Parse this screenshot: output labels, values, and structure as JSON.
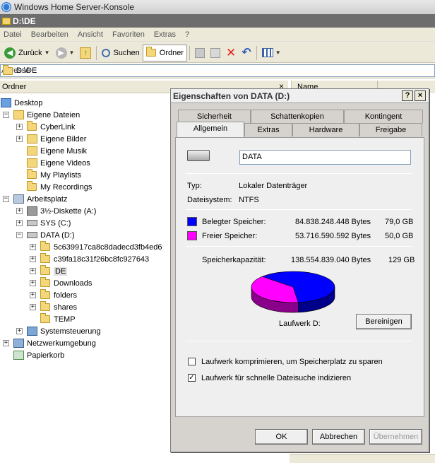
{
  "app": {
    "title": "Windows Home Server-Konsole",
    "doc_title": "D:\\DE"
  },
  "menu": [
    "Datei",
    "Bearbeiten",
    "Ansicht",
    "Favoriten",
    "Extras",
    "?"
  ],
  "toolbar": {
    "back_label": "Zurück",
    "search_label": "Suchen",
    "folders_label": "Ordner"
  },
  "address": {
    "label": "Adresse",
    "value": "D:\\DE"
  },
  "tree": {
    "header": "Ordner",
    "close": "×",
    "nodes": [
      {
        "label": "Desktop"
      },
      {
        "label": "Eigene Dateien"
      },
      {
        "label": "CyberLink"
      },
      {
        "label": "Eigene Bilder"
      },
      {
        "label": "Eigene Musik"
      },
      {
        "label": "Eigene Videos"
      },
      {
        "label": "My Playlists"
      },
      {
        "label": "My Recordings"
      },
      {
        "label": "Arbeitsplatz"
      },
      {
        "label": "3½-Diskette (A:)"
      },
      {
        "label": "SYS (C:)"
      },
      {
        "label": "DATA (D:)"
      },
      {
        "label": "5c639917ca8c8dadecd3fb4ed6"
      },
      {
        "label": "c39fa18c31f26bc8fc927643"
      },
      {
        "label": "DE"
      },
      {
        "label": "Downloads"
      },
      {
        "label": "folders"
      },
      {
        "label": "shares"
      },
      {
        "label": "TEMP"
      },
      {
        "label": "Systemsteuerung"
      },
      {
        "label": "Netzwerkumgebung"
      },
      {
        "label": "Papierkorb"
      }
    ]
  },
  "list_header": {
    "name": "Name"
  },
  "dialog": {
    "title": "Eigenschaften von DATA (D:)",
    "help": "?",
    "close": "×",
    "tabs_back": [
      "Sicherheit",
      "Schattenkopien",
      "Kontingent"
    ],
    "tabs_front": [
      "Allgemein",
      "Extras",
      "Hardware",
      "Freigabe"
    ],
    "drive_name": "DATA",
    "type_label": "Typ:",
    "type_value": "Lokaler Datenträger",
    "fs_label": "Dateisystem:",
    "fs_value": "NTFS",
    "used": {
      "label": "Belegter Speicher:",
      "bytes": "84.838.248.448 Bytes",
      "size": "79,0 GB",
      "color": "#0000ff",
      "fraction": 0.612
    },
    "free": {
      "label": "Freier Speicher:",
      "bytes": "53.716.590.592 Bytes",
      "size": "50,0 GB",
      "color": "#ff00ff"
    },
    "capacity": {
      "label": "Speicherkapazität:",
      "bytes": "138.554.839.040 Bytes",
      "size": "129 GB"
    },
    "drive_label": "Laufwerk D:",
    "cleanup": "Bereinigen",
    "compress_label": "Laufwerk komprimieren, um Speicherplatz zu sparen",
    "compress_checked": false,
    "index_label": "Laufwerk für schnelle Dateisuche indizieren",
    "index_checked": true,
    "ok": "OK",
    "cancel": "Abbrechen",
    "apply": "Übernehmen"
  }
}
